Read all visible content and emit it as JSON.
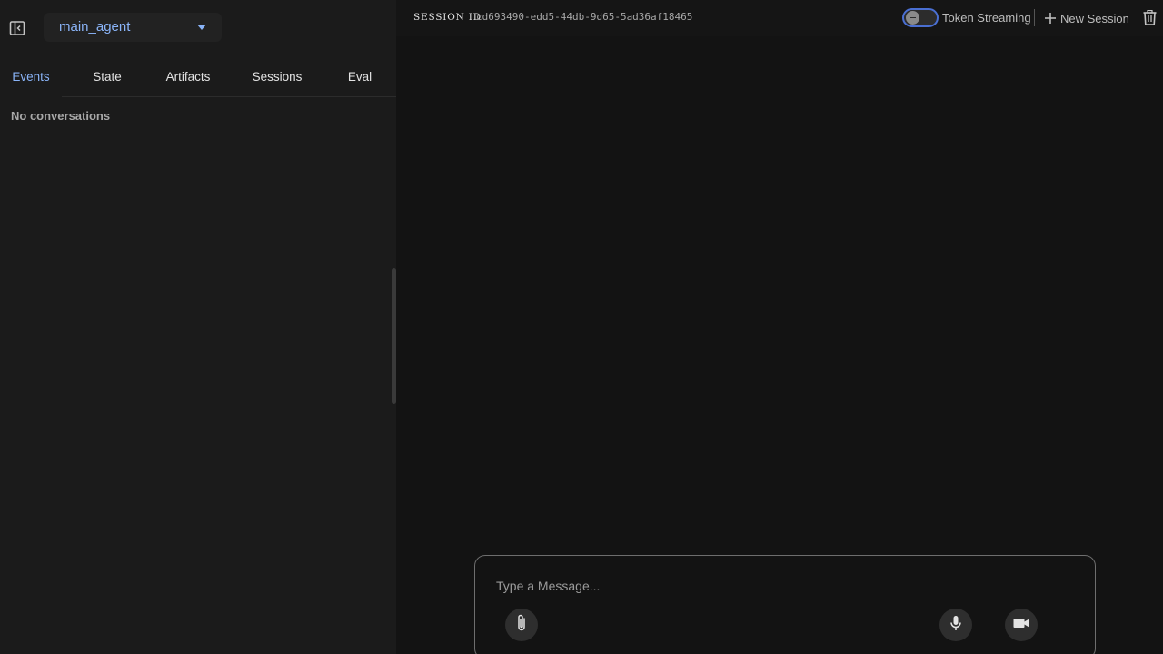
{
  "sidebar": {
    "agent_selector": {
      "value": "main_agent"
    },
    "tabs": [
      {
        "label": "Events",
        "active": true
      },
      {
        "label": "State",
        "active": false
      },
      {
        "label": "Artifacts",
        "active": false
      },
      {
        "label": "Sessions",
        "active": false
      },
      {
        "label": "Eval",
        "active": false
      }
    ],
    "empty_message": "No conversations",
    "icons": {
      "toggle": "sidebar-toggle-icon",
      "caret": "caret-down-icon"
    }
  },
  "header": {
    "session_label": "SESSION ID",
    "session_id": "cd693490-edd5-44db-9d65-5ad36af18465",
    "token_streaming": {
      "label": "Token Streaming",
      "enabled": false
    },
    "new_session_label": "New Session",
    "icons": {
      "new_session": "plus-icon",
      "delete": "trash-icon"
    }
  },
  "composer": {
    "placeholder": "Type a Message...",
    "value": "",
    "icons": {
      "attach": "paperclip-icon",
      "mic": "microphone-icon",
      "video": "video-camera-icon"
    }
  },
  "colors": {
    "accent": "#8ab4f8",
    "switch_border": "#4a6fd2",
    "sidebar_bg": "#1b1b1b",
    "main_bg": "#131313"
  }
}
